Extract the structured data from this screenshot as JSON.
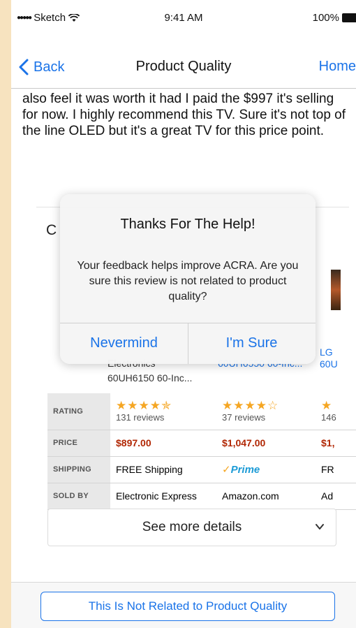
{
  "status_bar": {
    "carrier_dots": "●●●●●",
    "carrier": "Sketch",
    "time": "9:41 AM",
    "battery": "100%"
  },
  "nav": {
    "back_label": "Back",
    "title": "Product Quality",
    "home_label": "Home"
  },
  "review": {
    "text": "also feel it was worth it had I paid the $997 it's selling for now. I highly recommend this TV. Sure it's not top of the line OLED but it's a great TV for this price point."
  },
  "comparison": {
    "heading_fragment": "C",
    "products": [
      {
        "brand_fragment": "Electronics",
        "name": "60UH6150 60-Inc..."
      },
      {
        "brand_fragment": "",
        "name": "60UH6550 60-Inc..."
      },
      {
        "brand_fragment": "LG",
        "name": "60U"
      }
    ],
    "rows": {
      "rating_label": "RATING",
      "price_label": "PRICE",
      "shipping_label": "SHIPPING",
      "soldby_label": "SOLD BY"
    },
    "cols": [
      {
        "stars": "★★★★✯",
        "reviews": "131 reviews",
        "price": "$897.00",
        "shipping": "FREE Shipping",
        "sold_by": "Electronic Express"
      },
      {
        "stars": "★★★★☆",
        "reviews": "37 reviews",
        "price": "$1,047.00",
        "shipping": "Prime",
        "sold_by": "Amazon.com"
      },
      {
        "stars": "★",
        "reviews": "146",
        "price": "$1,",
        "shipping": "FR",
        "sold_by": "Ad"
      }
    ],
    "prime_check": "✓",
    "see_more_label": "See more details"
  },
  "bottom": {
    "not_related_label": "This Is Not Related to Product Quality"
  },
  "alert": {
    "title": "Thanks For The Help!",
    "message": "Your feedback helps improve ACRA. Are you sure this review is not related to product quality?",
    "cancel_label": "Nevermind",
    "confirm_label": "I'm Sure"
  },
  "colors": {
    "accent": "#1a73e8",
    "price": "#b12704",
    "star": "#f5a623",
    "background": "#f7e3bf"
  }
}
